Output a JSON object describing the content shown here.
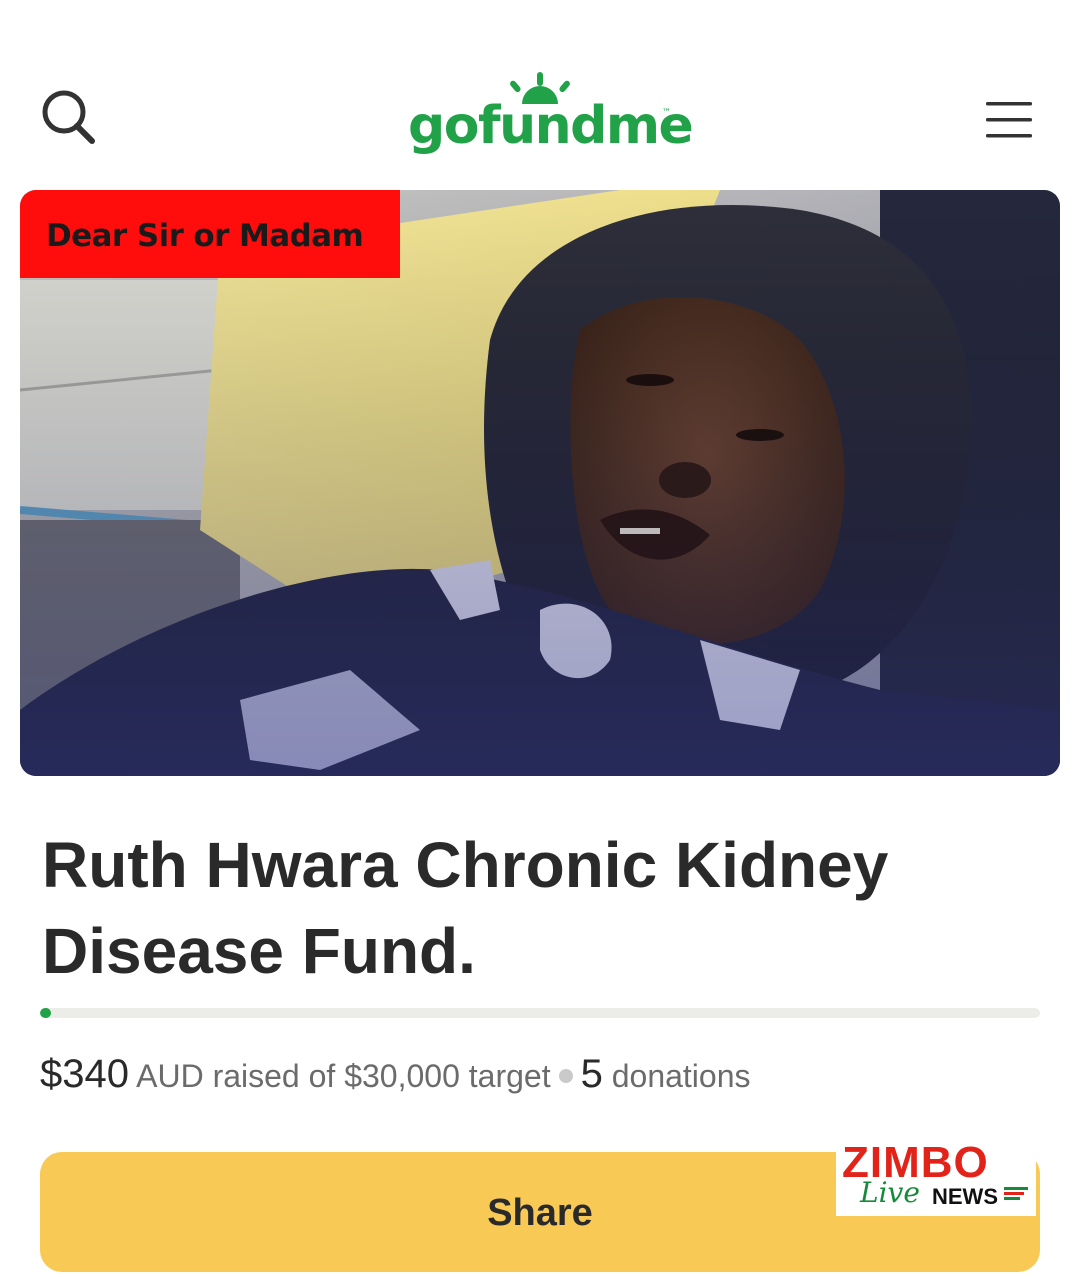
{
  "header": {
    "logo_text": "gofundme",
    "logo_tm": "™",
    "search_icon": "search-icon",
    "menu_icon": "hamburger-menu-icon",
    "brand_color": "#22a248"
  },
  "hero": {
    "banner_text": "Dear Sir or Madam",
    "banner_color": "#ff0d0d"
  },
  "campaign": {
    "title": "Ruth Hwara Chronic Kidney Disease Fund.",
    "raised_amount": "$340",
    "raised_suffix": "AUD raised of $30,000 target",
    "donation_count": "5",
    "donations_label": "donations",
    "progress_fraction": 0.0113
  },
  "actions": {
    "share_label": "Share",
    "share_color": "#f8ca55"
  },
  "watermark": {
    "line1": "ZIMBO",
    "line2": "Live",
    "line3": "NEWS"
  }
}
